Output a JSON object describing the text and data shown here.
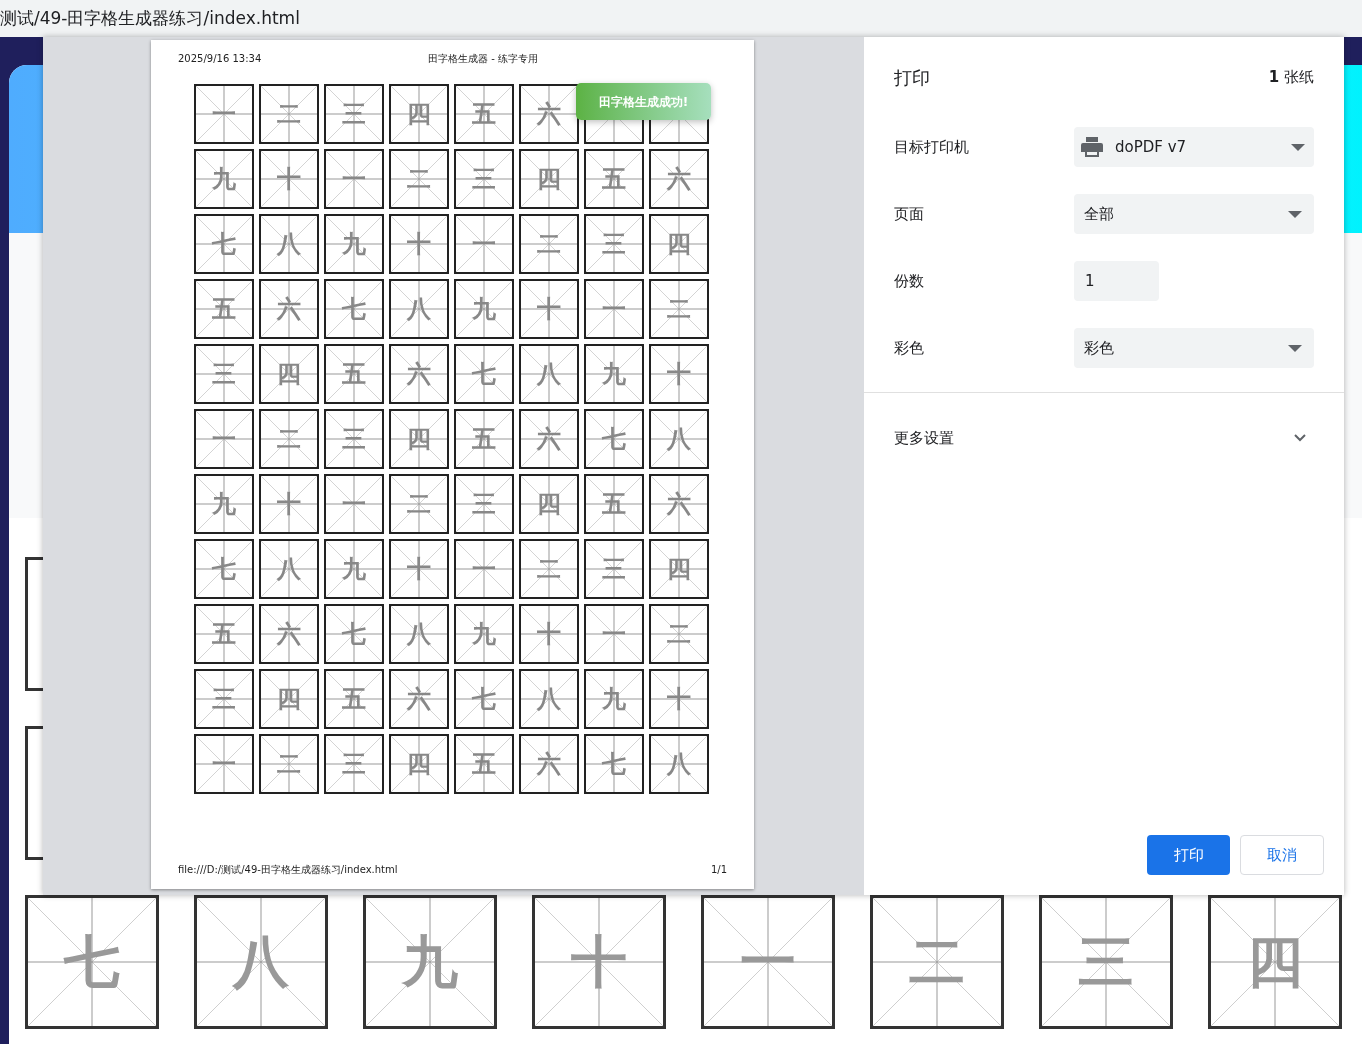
{
  "address_bar": {
    "url": "测试/49-田字格生成器练习/index.html"
  },
  "background_page": {
    "cells": [
      "七",
      "八",
      "九",
      "十",
      "一",
      "二",
      "三",
      "四"
    ]
  },
  "print_preview": {
    "header_date": "2025/9/16 13:34",
    "header_title": "田字格生成器 - 练字专用",
    "rows": [
      [
        "一",
        "二",
        "三",
        "四",
        "五",
        "六"
      ],
      [
        "九",
        "十",
        "一",
        "二",
        "三",
        "四",
        "五",
        "六"
      ],
      [
        "七",
        "八",
        "九",
        "十",
        "一",
        "二",
        "三",
        "四"
      ],
      [
        "五",
        "六",
        "七",
        "八",
        "九",
        "十",
        "一",
        "二"
      ],
      [
        "三",
        "四",
        "五",
        "六",
        "七",
        "八",
        "九",
        "十"
      ],
      [
        "一",
        "二",
        "三",
        "四",
        "五",
        "六",
        "七",
        "八"
      ],
      [
        "九",
        "十",
        "一",
        "二",
        "三",
        "四",
        "五",
        "六"
      ],
      [
        "七",
        "八",
        "九",
        "十",
        "一",
        "二",
        "三",
        "四"
      ],
      [
        "五",
        "六",
        "七",
        "八",
        "九",
        "十",
        "一",
        "二"
      ],
      [
        "三",
        "四",
        "五",
        "六",
        "七",
        "八",
        "九",
        "十"
      ],
      [
        "一",
        "二",
        "三",
        "四",
        "五",
        "六",
        "七",
        "八"
      ]
    ],
    "toast": "田字格生成成功!",
    "footer_url": "file:///D:/测试/49-田字格生成器练习/index.html",
    "footer_page": "1/1"
  },
  "print_panel": {
    "title": "打印",
    "sheets": "**1** 张纸",
    "settings": [
      {
        "kind": "printer",
        "label": "目标打印机",
        "value": "doPDF v7"
      },
      {
        "kind": "select",
        "label": "页面",
        "value": "全部"
      },
      {
        "kind": "number",
        "label": "份数",
        "value": "1"
      },
      {
        "kind": "select",
        "label": "彩色",
        "value": "彩色"
      }
    ],
    "more_settings": {
      "label": "更多设置",
      "expanded": false
    },
    "buttons": [
      {
        "kind": "primary",
        "label": "打印"
      },
      {
        "kind": "secondary",
        "label": "取消"
      }
    ]
  }
}
